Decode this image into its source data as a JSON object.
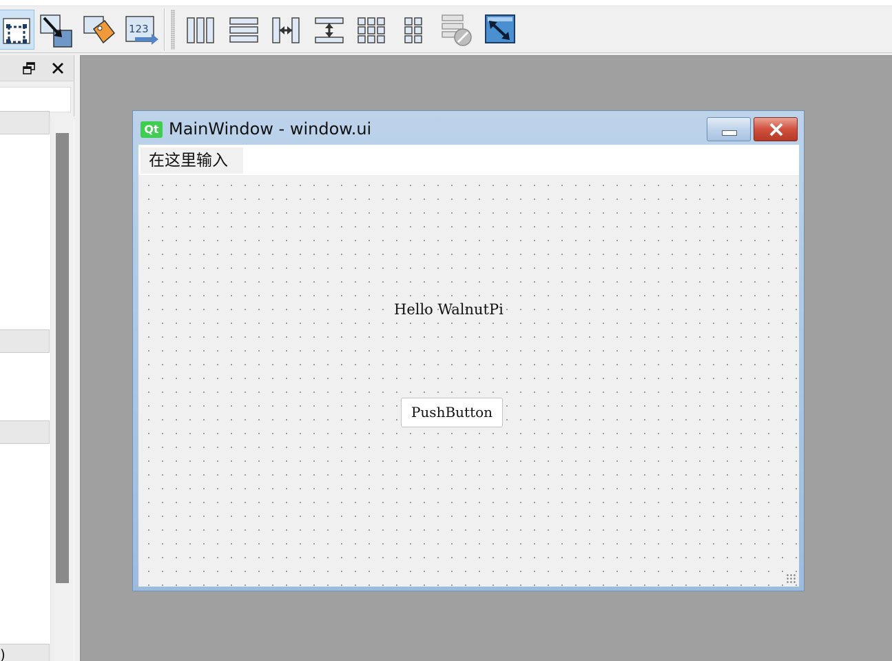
{
  "toolbar": {
    "buttons": [
      {
        "name": "edit-widgets",
        "active": true
      },
      {
        "name": "edit-signals-slots"
      },
      {
        "name": "edit-buddies"
      },
      {
        "name": "edit-tab-order"
      },
      {
        "name": "layout-horizontally"
      },
      {
        "name": "layout-vertically"
      },
      {
        "name": "layout-horizontal-splitter"
      },
      {
        "name": "layout-vertical-splitter"
      },
      {
        "name": "layout-in-grid"
      },
      {
        "name": "layout-in-form"
      },
      {
        "name": "break-layout"
      },
      {
        "name": "adjust-size"
      }
    ]
  },
  "dock": {
    "category_partial_label": ")"
  },
  "form_window": {
    "icon_text": "Qt",
    "title": "MainWindow - window.ui",
    "menu_item": "在这里输入",
    "label_text": "Hello WalnutPi",
    "button_text": "PushButton"
  },
  "colors": {
    "accent_blue": "#9dbcdd",
    "close_red": "#c8462f",
    "qt_green": "#41cd52",
    "mdi_gray": "#a0a0a0"
  }
}
